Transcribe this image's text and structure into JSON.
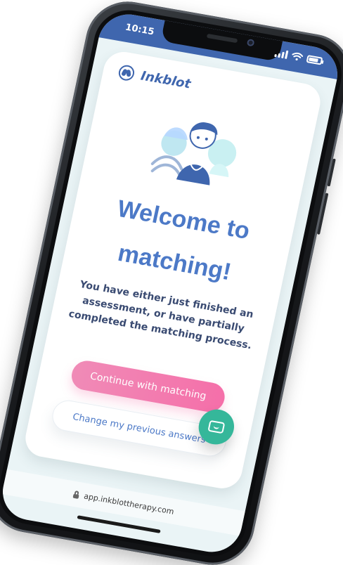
{
  "status_bar": {
    "time": "10:15"
  },
  "brand": {
    "name": "Inkblot",
    "logo_icon": "inkblot-logo-icon"
  },
  "main": {
    "title_lines": [
      "Welcome to",
      "matching!"
    ],
    "subtitle_lines": [
      "You have either just finished an",
      "assessment, or have partially",
      "completed the matching process."
    ],
    "primary_button_label": "Continue with matching",
    "secondary_button_label": "Change my previous answers"
  },
  "browser": {
    "url": "app.inkblottherapy.com"
  },
  "icons": {
    "chat": "chat-icon",
    "lock": "lock-icon",
    "signal": "signal-icon",
    "wifi": "wifi-icon",
    "battery": "battery-icon",
    "illustration": "people-illustration-icon"
  },
  "colors": {
    "status_bar_bg": "#3f66ae",
    "title": "#4c79c7",
    "subtitle": "#3a4b72",
    "primary_btn_start": "#f08bb7",
    "primary_btn_end": "#f56fa9",
    "chat_fab": "#35b79a"
  }
}
